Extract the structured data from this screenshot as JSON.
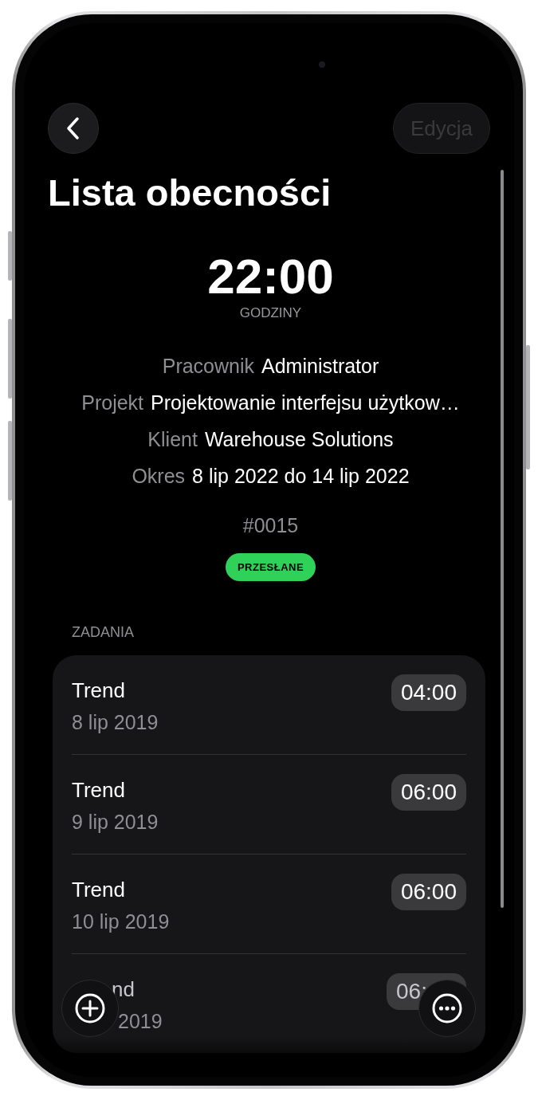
{
  "edit_button": {
    "label": "Edycja",
    "disabled": true
  },
  "title": "Lista obecności",
  "total": {
    "value": "22:00",
    "unit": "GODZINY"
  },
  "details": [
    {
      "label": "Pracownik",
      "value": "Administrator"
    },
    {
      "label": "Projekt",
      "value": "Projektowanie interfejsu użytkow…"
    },
    {
      "label": "Klient",
      "value": "Warehouse Solutions"
    },
    {
      "label": "Okres",
      "value": "8 lip 2022 do 14 lip 2022"
    }
  ],
  "number": "#0015",
  "status": "PRZESŁANE",
  "section_title": "ZADANIA",
  "tasks": [
    {
      "title": "Trend",
      "date": "8 lip 2019",
      "duration": "04:00",
      "obscured": false
    },
    {
      "title": "Trend",
      "date": "9 lip 2019",
      "duration": "06:00",
      "obscured": false
    },
    {
      "title": "Trend",
      "date": "10 lip 2019",
      "duration": "06:00",
      "obscured": false
    },
    {
      "title": "nd",
      "date": "2019",
      "duration": "06:",
      "obscured": true
    }
  ]
}
